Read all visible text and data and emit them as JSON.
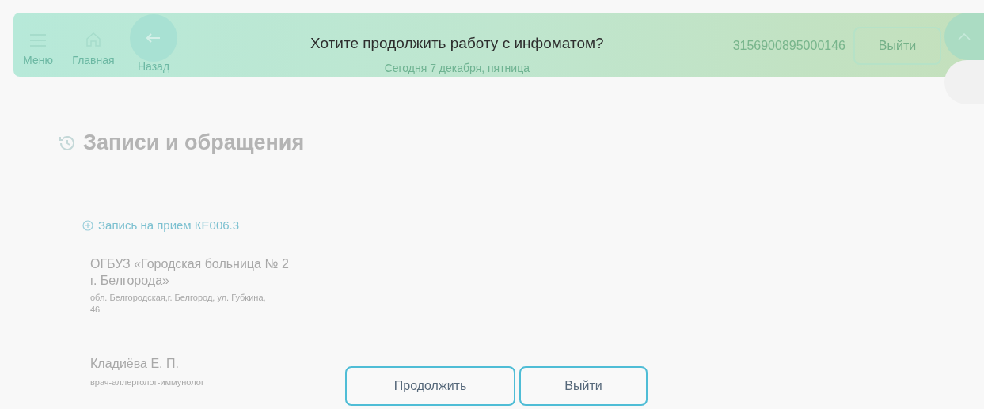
{
  "header": {
    "menu_label": "Меню",
    "home_label": "Главная",
    "back_label": "Назад",
    "date": "Сегодня 7 декабря, пятница",
    "terminal_id": "3156900895000146",
    "logout_button": "Выйти"
  },
  "page": {
    "title": "Записи и обращения",
    "appointment": {
      "link": "Запись на прием КЕ006.3",
      "clinic": "ОГБУЗ «Городская больница № 2 г. Белгорода»",
      "address": "обл. Белгородская,г. Белгород, ул. Губкина, 46",
      "doctor": "Кладиёва Е. П.",
      "specialty": "врач-аллерголог-иммунолог"
    }
  },
  "dialog": {
    "question": "Хотите продолжить работу с инфоматом?",
    "buttons": [
      "Продолжить",
      "Выйти"
    ]
  }
}
